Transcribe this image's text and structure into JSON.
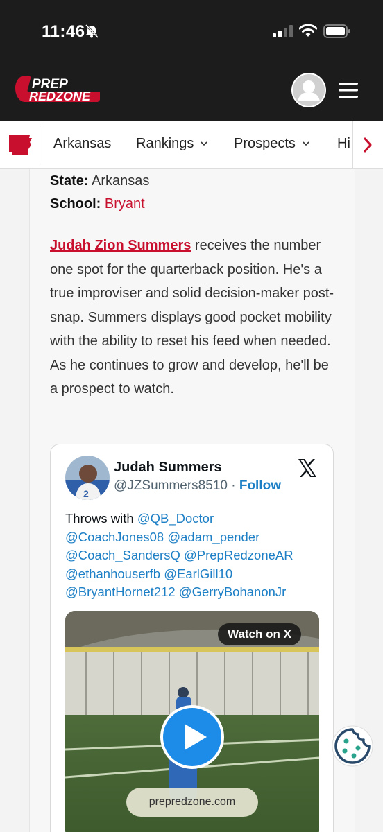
{
  "status_bar": {
    "time": "11:46"
  },
  "header": {
    "logo": {
      "line1": "PREP",
      "line2": "REDZONE"
    }
  },
  "nav": {
    "items": [
      {
        "label": "Arkansas",
        "has_dropdown": false
      },
      {
        "label": "Rankings",
        "has_dropdown": true
      },
      {
        "label": "Prospects",
        "has_dropdown": true
      },
      {
        "label": "Hi",
        "has_dropdown": false
      }
    ]
  },
  "profile": {
    "state_label": "State:",
    "state_value": "Arkansas",
    "school_label": "School:",
    "school_value": "Bryant"
  },
  "article": {
    "player_link": "Judah Zion Summers",
    "body": " receives the number one spot for the quarterback position. He's a true improviser and solid decision-maker post-snap. Summers displays good pocket mobility with the ability to reset his feed when needed. As he continues to grow and develop, he'll be a prospect to watch."
  },
  "tweet": {
    "name": "Judah Summers",
    "handle": "@JZSummers8510",
    "separator": " · ",
    "follow": "Follow",
    "text_prefix": "Throws with ",
    "mentions": [
      "@QB_Doctor",
      "@CoachJones08",
      "@adam_pender",
      "@Coach_SandersQ",
      "@PrepRedzoneAR",
      "@ethanhouserfb",
      "@EarlGill10",
      "@BryantHornet212",
      "@GerryBohanonJr"
    ],
    "watch_label": "Watch on X",
    "site_label": "prepredzone.com"
  },
  "colors": {
    "accent_red": "#c8102e",
    "link_blue": "#1d7fc5",
    "header_bg": "#1c1c1c",
    "cookie_teal": "#2aa38d"
  }
}
